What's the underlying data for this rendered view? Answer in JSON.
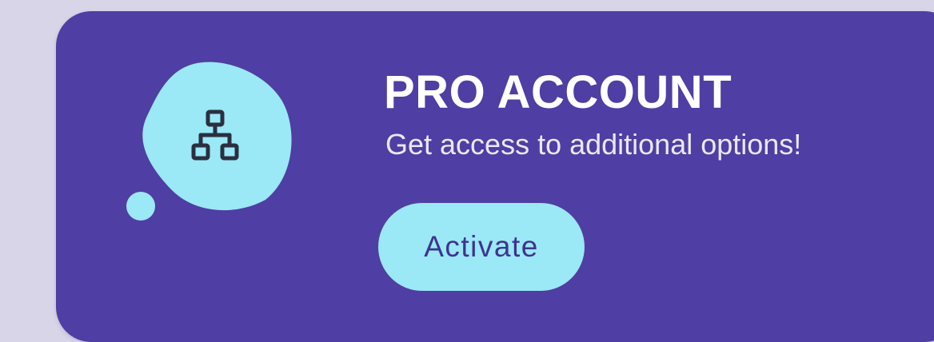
{
  "promo": {
    "title": "PRO ACCOUNT",
    "subtitle": "Get access to additional options!",
    "button_label": "Activate",
    "icon": "sitemap-icon"
  },
  "colors": {
    "page_background": "#d8d5e8",
    "card_background": "#4f3ea3",
    "accent": "#9be8f6",
    "icon_stroke": "#2a2f3f",
    "title_text": "#ffffff",
    "button_text": "#3d3490"
  }
}
